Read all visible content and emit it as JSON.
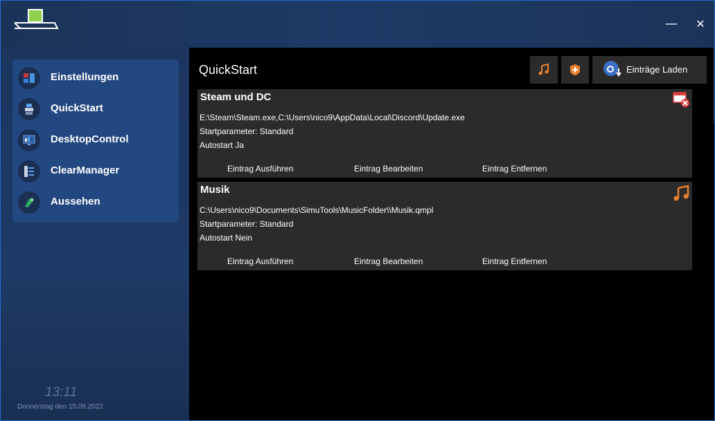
{
  "window": {
    "minimize": "—",
    "close": "✕"
  },
  "sidebar": {
    "items": [
      {
        "label": "Einstellungen",
        "icon": "settings-panel-icon"
      },
      {
        "label": "QuickStart",
        "icon": "cube-stack-icon"
      },
      {
        "label": "DesktopControl",
        "icon": "desktop-icon"
      },
      {
        "label": "ClearManager",
        "icon": "list-icon"
      },
      {
        "label": "Aussehen",
        "icon": "paint-icon"
      }
    ],
    "time": "13:11",
    "date": "Donnerstag den 15.09.2022"
  },
  "main": {
    "title": "QuickStart",
    "toolbar": {
      "music_icon": "music-note-icon",
      "add_icon": "add-shield-icon",
      "load_label": "Einträge Laden"
    },
    "entries": [
      {
        "title": "Steam und DC",
        "path": "E:\\Steam\\Steam.exe,C:\\Users\\nico9\\AppData\\Local\\Discord\\Update.exe",
        "params": "Startparameter: Standard",
        "autostart": "Autostart  Ja",
        "run": "Eintrag Ausführen",
        "edit": "Eintrag Bearbeiten",
        "remove": "Eintrag Entfernen",
        "icon": "window-remove-icon"
      },
      {
        "title": "Musik",
        "path": "C:\\Users\\nico9\\Documents\\SimuTools\\MusicFolder\\\\Musik.qmpl",
        "params": "Startparameter: Standard",
        "autostart": "Autostart  Nein",
        "run": "Eintrag Ausführen",
        "edit": "Eintrag Bearbeiten",
        "remove": "Eintrag Entfernen",
        "icon": "music-note-icon"
      }
    ]
  },
  "colors": {
    "accent_blue": "#234780",
    "title_bar": "#1d3a66",
    "card_bg": "#2b2b2b",
    "icon_orange": "#e8822e"
  }
}
